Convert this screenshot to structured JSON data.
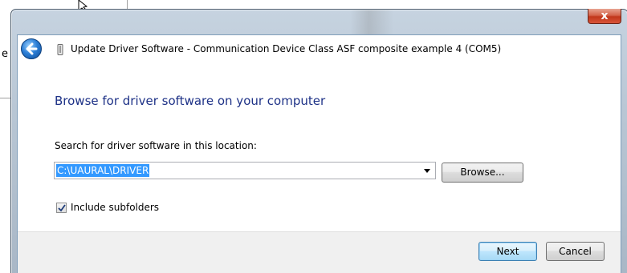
{
  "background_window": {
    "partial_letter": "e"
  },
  "dialog": {
    "title": "Update Driver Software - Communication Device Class ASF composite example 4 (COM5)",
    "close_label": "x",
    "heading": "Browse for driver software on your computer",
    "search_label": "Search for driver software in this location:",
    "path_value": "C:\\UAURAL\\DRIVER",
    "browse_label": "Browse...",
    "include_subfolders_label": "Include subfolders",
    "include_subfolders_checked": true,
    "next_label": "Next",
    "cancel_label": "Cancel"
  },
  "icons": {
    "back": "back-arrow-icon",
    "device": "device-icon",
    "dropdown": "chevron-down-icon",
    "check": "checkmark-icon",
    "cursor": "mouse-cursor-icon"
  },
  "colors": {
    "heading": "#1e3287",
    "selection": "#3399ff",
    "close_button": "#c1371b",
    "back_button": "#2d7fd6"
  }
}
